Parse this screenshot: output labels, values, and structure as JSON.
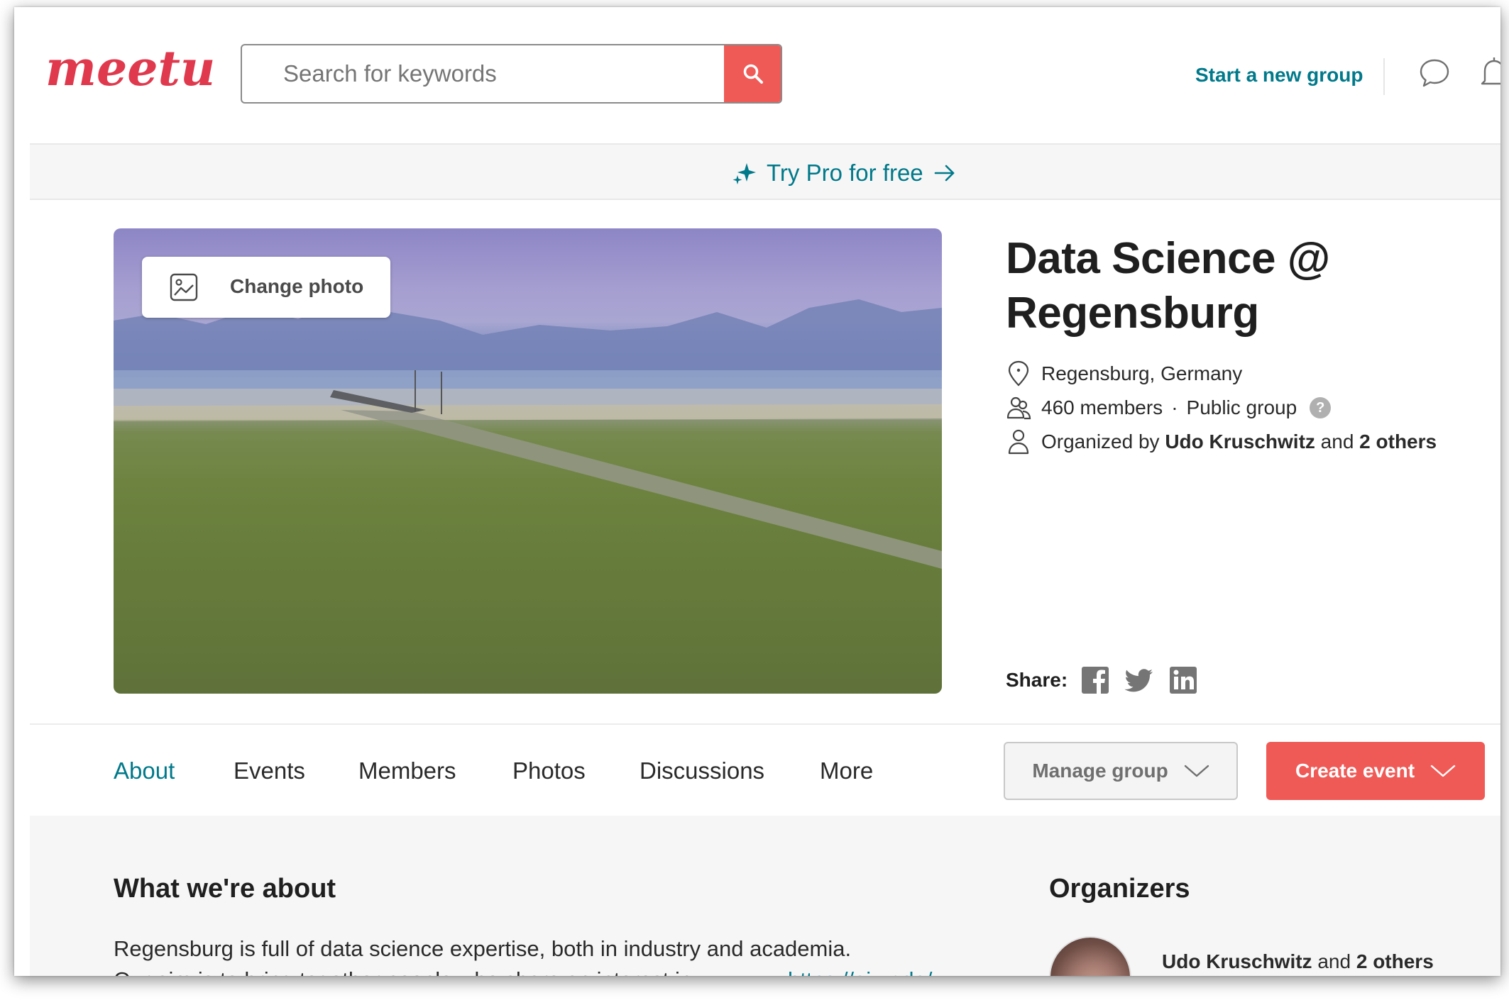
{
  "header": {
    "logo_text": "meetup",
    "search": {
      "placeholder": "Search for keywords",
      "value": ""
    },
    "start_group_label": "Start a new group"
  },
  "promo": {
    "label": "Try Pro for free"
  },
  "hero": {
    "change_photo_label": "Change photo",
    "title": "Data Science @ Regensburg",
    "location": "Regensburg, Germany",
    "members": "460 members",
    "separator": "·",
    "visibility": "Public group",
    "help": "?",
    "organized_prefix": "Organized by",
    "organizer_name": "Udo Kruschwitz",
    "organized_and": "and",
    "organizer_others": "2 others",
    "share_label": "Share:"
  },
  "tabs": [
    {
      "label": "About",
      "active": true
    },
    {
      "label": "Events",
      "active": false
    },
    {
      "label": "Members",
      "active": false
    },
    {
      "label": "Photos",
      "active": false
    },
    {
      "label": "Discussions",
      "active": false
    },
    {
      "label": "More",
      "active": false
    }
  ],
  "actions": {
    "manage_label": "Manage group",
    "create_label": "Create event"
  },
  "about": {
    "heading": "What we're about",
    "line1": "Regensburg is full of data science expertise, both in industry and academia.",
    "line2": "Our aim is to bring together people who share an interest in ...",
    "link": "https://ai.ur.de/"
  },
  "organizers": {
    "heading": "Organizers",
    "name": "Udo Kruschwitz",
    "and": "and",
    "others": "2 others"
  },
  "colors": {
    "brand_red": "#f05a56",
    "teal": "#00798a",
    "logo_pink": "#e0394d"
  }
}
